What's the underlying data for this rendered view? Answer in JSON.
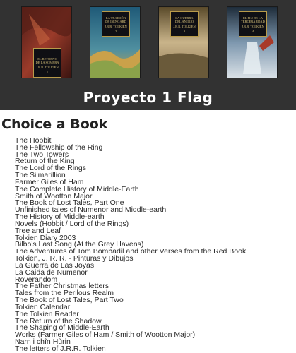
{
  "header": {
    "title": "Proyecto 1 Flag",
    "covers": [
      {
        "name": "cover-el-retorno-de-la-sombra",
        "lines": [
          "EL RETORNO",
          "DE LA SOMBRA",
          "J.R.R. TOLKIEN"
        ],
        "volume": "1",
        "accent": "#8a2f22"
      },
      {
        "name": "cover-la-traicion-de-isengard",
        "lines": [
          "LA TRAICIÓN",
          "DE ISENGARD",
          "J.R.R. TOLKIEN"
        ],
        "volume": "2",
        "accent": "#3a7a8a"
      },
      {
        "name": "cover-la-guerra-del-anillo",
        "lines": [
          "LA GUERRA",
          "DEL ANILLO",
          "J.R.R. TOLKIEN"
        ],
        "volume": "3",
        "accent": "#a4813d"
      },
      {
        "name": "cover-el-fin-de-la-tercera-edad",
        "lines": [
          "EL FIN DE LA",
          "TERCERA EDAD",
          "J.R.R. TOLKIEN"
        ],
        "volume": "4",
        "accent": "#6a7f95"
      }
    ]
  },
  "main": {
    "heading": "Choice a Book",
    "books": [
      "The Hobbit",
      "The Fellowship of the Ring",
      "The Two Towers",
      "Return of the King",
      "The Lord of the Rings",
      "The Silmarillion",
      "Farmer Giles of Ham",
      "The Complete History of Middle-Earth",
      "Smith of Wootton Major",
      "The Book of Lost Tales, Part One",
      "Unfinished tales of Numenor and Middle-earth",
      "The History of Middle-earth",
      "Novels (Hobbit / Lord of the Rings)",
      "Tree and Leaf",
      "Tolkien Diary 2003",
      "Bilbo's Last Song (At the Grey Havens)",
      "The Adventures of Tom Bombadil and other Verses from the Red Book",
      "Tolkien, J. R. R. - Pinturas y Dibujos",
      "La Guerra de Las Joyas",
      "La Caida de Numenor",
      "Roverandom",
      "The Father Christmas letters",
      "Tales from the Perilous Realm",
      "The Book of Lost Tales, Part Two",
      "Tolkien Calendar",
      "The Tolkien Reader",
      "The Return of the Shadow",
      "The Shaping of Middle-Earth",
      "Works (Farmer Giles of Ham / Smith of Wootton Major)",
      "Narn i chîn Hùrin",
      "The letters of J.R.R. Tolkien"
    ]
  }
}
